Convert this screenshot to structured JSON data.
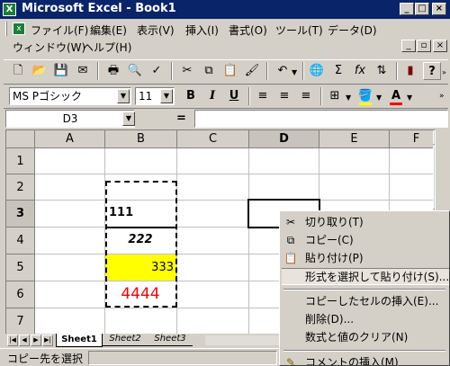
{
  "window": {
    "title": "Microsoft Excel - Book1",
    "app_icon_label": "X",
    "caption_buttons": [
      "_",
      "□",
      "×"
    ],
    "doc_buttons": [
      "_",
      "▫",
      "×"
    ]
  },
  "menu": {
    "row1": [
      "ファイル(F)",
      "編集(E)",
      "表示(V)",
      "挿入(I)",
      "書式(O)",
      "ツール(T)",
      "データ(D)"
    ],
    "row2": [
      "ウィンドウ(W)",
      "ヘルプ(H)"
    ]
  },
  "toolbar": {
    "font_name": "MS Pゴシック",
    "font_size": "11",
    "bold": "B",
    "italic": "I",
    "underline": "U",
    "autosum": "Σ",
    "function": "fx",
    "help": "?"
  },
  "formula_bar": {
    "name_box": "D3",
    "equals": "=",
    "value": ""
  },
  "sheet": {
    "columns": [
      "A",
      "B",
      "C",
      "D",
      "E",
      "F"
    ],
    "rows": [
      "1",
      "2",
      "3",
      "4",
      "5",
      "6",
      "7"
    ],
    "cells": {
      "B3": "111",
      "B4": "222",
      "B5": "333",
      "B6": "4444"
    },
    "selected_cell": "D3",
    "copy_range": "B3:B6",
    "fill_yellow": "#ffff00",
    "red_text": "#ff0000"
  },
  "tabs": [
    "Sheet1",
    "Sheet2",
    "Sheet3"
  ],
  "status": {
    "text": "コピー先を選択"
  },
  "context_menu": {
    "items": [
      {
        "label": "切り取り(T)",
        "icon": "scissors-icon"
      },
      {
        "label": "コピー(C)",
        "icon": "copy-icon"
      },
      {
        "label": "貼り付け(P)",
        "icon": "paste-icon"
      },
      {
        "label": "形式を選択して貼り付け(S)...",
        "icon": ""
      },
      {
        "label": "コピーしたセルの挿入(E)...",
        "icon": ""
      },
      {
        "label": "削除(D)...",
        "icon": ""
      },
      {
        "label": "数式と値のクリア(N)",
        "icon": ""
      },
      {
        "label": "コメントの挿入(M)",
        "icon": "comment-icon"
      }
    ],
    "highlighted_index": 3
  }
}
